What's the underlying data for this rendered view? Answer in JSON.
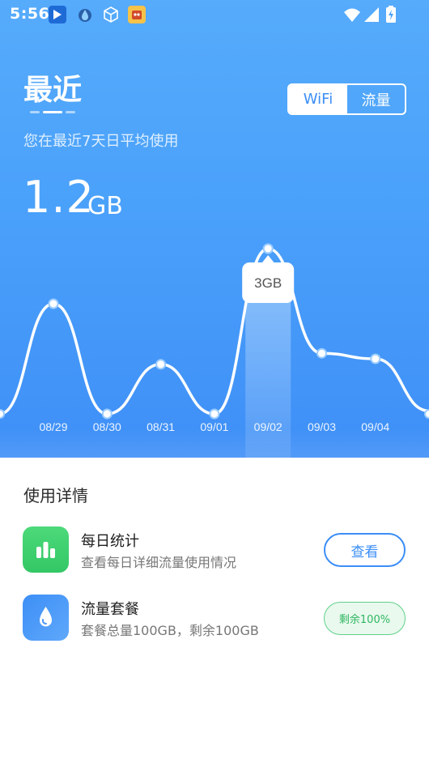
{
  "status_bar": {
    "time": "5:56",
    "icons": [
      "app-icon",
      "water-drop-icon",
      "cube-icon",
      "game-icon",
      "wifi-icon",
      "signal-icon",
      "battery-icon"
    ]
  },
  "header": {
    "title": "最近",
    "subtitle": "您在最近7天日平均使用",
    "usage_value": "1.2",
    "usage_unit": "GB",
    "tabs": [
      {
        "label": "WiFi",
        "selected": true
      },
      {
        "label": "流量",
        "selected": false
      }
    ]
  },
  "chart_data": {
    "type": "line",
    "categories": [
      "08/29",
      "08/30",
      "08/31",
      "09/01",
      "09/02",
      "09/03",
      "09/04"
    ],
    "series": [
      {
        "values": [
          2.0,
          0.0,
          0.9,
          0.0,
          3.0,
          1.1,
          1.0
        ]
      }
    ],
    "highlight": {
      "category": "09/02",
      "label": "3GB"
    }
  },
  "details": {
    "title": "使用详情",
    "items": [
      {
        "icon": "bar-chart-icon",
        "title": "每日统计",
        "desc": "查看每日详细流量使用情况",
        "action_label": "查看"
      },
      {
        "icon": "water-drop-icon",
        "title": "流量套餐",
        "desc": "套餐总量100GB，剩余100GB",
        "badge": "剩余100%"
      }
    ]
  },
  "colors": {
    "accent": "#3b8ef6",
    "gradient_top": "#56abfb",
    "gradient_bottom": "#3f8ff7",
    "green": "#34c766"
  }
}
